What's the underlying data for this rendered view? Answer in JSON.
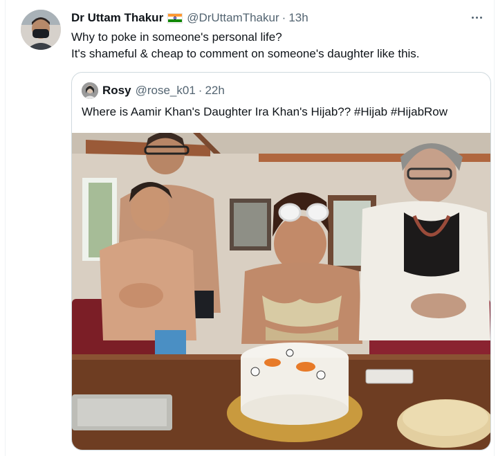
{
  "tweet": {
    "author_name": "Dr Uttam Thakur",
    "author_flag": "india-flag-icon",
    "author_handle": "@DrUttamThakur",
    "separator": "·",
    "time": "13h",
    "text_line1": "Why to poke in someone's personal life?",
    "text_line2": "It's shameful & cheap to comment on someone's daughter like this."
  },
  "quoted": {
    "author_name": "Rosy",
    "author_handle": "@rose_k01",
    "separator": "·",
    "time": "22h",
    "text": "Where is Aamir Khan's Daughter Ira Khan's Hijab?? #Hijab #HijabRow"
  },
  "icons": {
    "more": "more-horizontal-icon",
    "flag": "india-flag-icon"
  },
  "colors": {
    "text_primary": "#0f1419",
    "text_secondary": "#536471",
    "border": "#cfd9de",
    "flag_saffron": "#ff9933",
    "flag_green": "#138808"
  }
}
